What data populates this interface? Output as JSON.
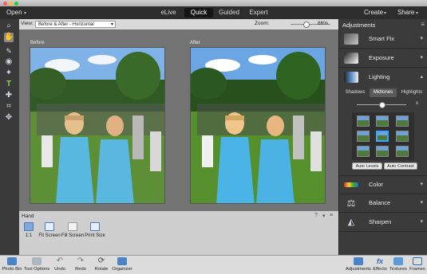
{
  "topbar": {
    "open_label": "Open",
    "modes": [
      "eLive",
      "Quick",
      "Guided",
      "Expert"
    ],
    "active_mode": "Quick",
    "create_label": "Create",
    "share_label": "Share"
  },
  "viewbar": {
    "view_label": "View:",
    "view_value": "Before & After - Horizontal",
    "zoom_label": "Zoom:",
    "zoom_value": "86%"
  },
  "canvas": {
    "before_label": "Before",
    "after_label": "After"
  },
  "hand_panel": {
    "title": "Hand",
    "options": [
      "1:1",
      "Fit Screen",
      "Fill Screen",
      "Print Size"
    ]
  },
  "adjustments": {
    "title": "Adjustments",
    "items": [
      {
        "label": "Smart Fix",
        "arrow": "▾"
      },
      {
        "label": "Exposure",
        "arrow": "▾"
      },
      {
        "label": "Lighting",
        "arrow": "▴"
      }
    ],
    "subtabs": [
      "Shadows",
      "Midtones",
      "Highlights"
    ],
    "active_subtab": "Midtones",
    "slider_value": "x",
    "auto_levels": "Auto Levels",
    "auto_contrast": "Auto Contrast",
    "bottom_items": [
      {
        "label": "Color",
        "arrow": "▾"
      },
      {
        "label": "Balance",
        "arrow": "▾"
      },
      {
        "label": "Sharpen",
        "arrow": "▾"
      }
    ]
  },
  "bottombar": {
    "left": [
      "Photo Bin",
      "Tool Options",
      "Undo",
      "Redo",
      "Rotate",
      "Organizer"
    ],
    "right": [
      "Adjustments",
      "Effects",
      "Textures",
      "Frames"
    ]
  },
  "colors": {
    "accent": "#3aa6ff",
    "panel_dark": "#3b3b3b",
    "topbar": "#2d2d2d"
  }
}
